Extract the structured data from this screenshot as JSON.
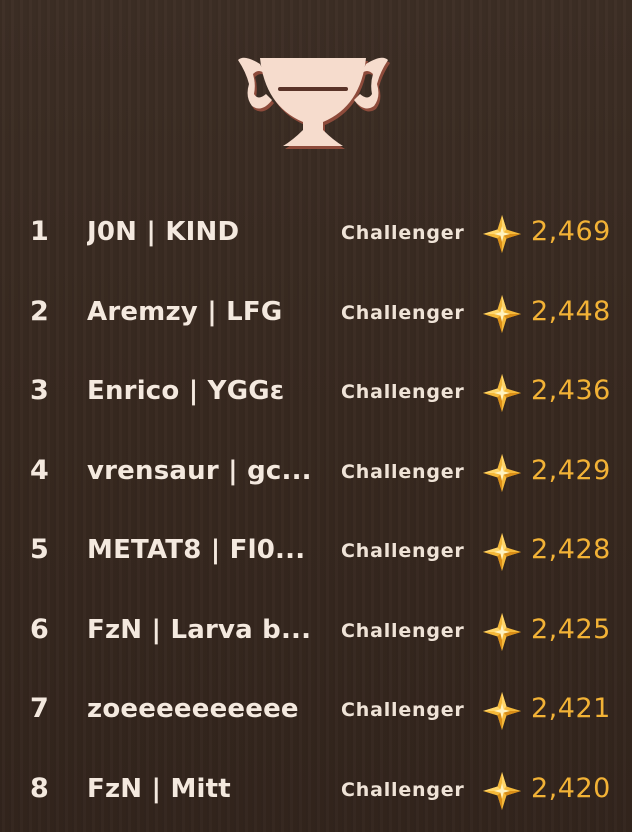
{
  "leaderboard": {
    "trophy_icon": "trophy-icon",
    "points_icon": "gold-star-icon",
    "rows": [
      {
        "rank": "1",
        "player": "J0N | KIND",
        "tier": "Challenger",
        "points": "2,469"
      },
      {
        "rank": "2",
        "player": "Aremzy | LFG",
        "tier": "Challenger",
        "points": "2,448"
      },
      {
        "rank": "3",
        "player": "Enrico | YGGɛ",
        "tier": "Challenger",
        "points": "2,436"
      },
      {
        "rank": "4",
        "player": "vrensaur | gc...",
        "tier": "Challenger",
        "points": "2,429"
      },
      {
        "rank": "5",
        "player": "METAT8 | Fl0...",
        "tier": "Challenger",
        "points": "2,428"
      },
      {
        "rank": "6",
        "player": "FzN | Larva b...",
        "tier": "Challenger",
        "points": "2,425"
      },
      {
        "rank": "7",
        "player": "zoeeeeeeeeee",
        "tier": "Challenger",
        "points": "2,421"
      },
      {
        "rank": "8",
        "player": "FzN | Mitt",
        "tier": "Challenger",
        "points": "2,420"
      }
    ]
  },
  "colors": {
    "background": "#3a2b22",
    "text": "#f4e9df",
    "points": "#f2b236",
    "star": "#f5b93a",
    "trophy": "#f6dccd"
  }
}
